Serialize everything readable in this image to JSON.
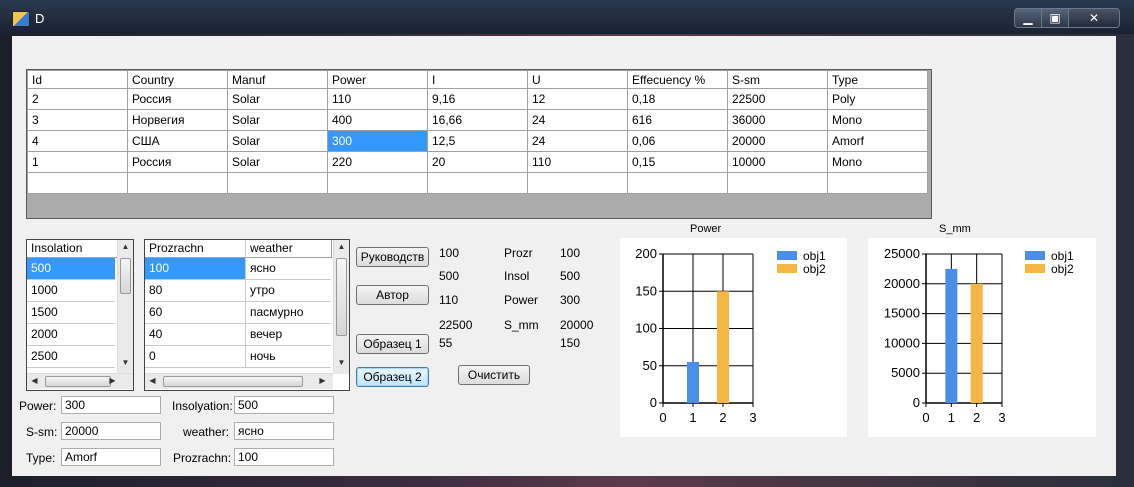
{
  "window": {
    "title": "D",
    "min_label": "▁",
    "max_label": "▣",
    "close_label": "✕"
  },
  "grid": {
    "columns": [
      "Id",
      "Country",
      "Manuf",
      "Power",
      "I",
      "U",
      "Effecuency %",
      "S-sm",
      "Type"
    ],
    "rows": [
      [
        "2",
        "Россия",
        "Solar",
        "110",
        "9,16",
        "12",
        "0,18",
        "22500",
        "Poly"
      ],
      [
        "3",
        "Норвегия",
        "Solar",
        "400",
        "16,66",
        "24",
        "616",
        "36000",
        "Mono"
      ],
      [
        "4",
        "США",
        "Solar",
        "300",
        "12,5",
        "24",
        "0,06",
        "20000",
        "Amorf"
      ],
      [
        "1",
        "Россия",
        "Solar",
        "220",
        "20",
        "110",
        "0,15",
        "10000",
        "Mono"
      ],
      [
        "",
        "",
        "",
        "",
        "",
        "",
        "",
        "",
        ""
      ]
    ],
    "selected_row": 2,
    "selected_col": 3
  },
  "insolation_list": {
    "header": "Insolation",
    "items": [
      "500",
      "1000",
      "1500",
      "2000",
      "2500"
    ],
    "selected": 0
  },
  "prozrachn_list": {
    "headers": [
      "Prozrachn",
      "weather"
    ],
    "rows": [
      [
        "100",
        "ясно"
      ],
      [
        "80",
        "утро"
      ],
      [
        "60",
        "пасмурно"
      ],
      [
        "40",
        "вечер"
      ],
      [
        "0",
        "ночь"
      ]
    ],
    "selected": 0
  },
  "buttons": {
    "rukovodstvo": "Руководств",
    "avtor": "Автор",
    "obrazec1": "Образец 1",
    "obrazec2": "Образец 2",
    "ochistit": "Очистить"
  },
  "values_col1": [
    "100",
    "500",
    "110",
    "22500",
    "55"
  ],
  "labels_col2": [
    "Prozr",
    "Insol",
    "Power",
    "S_mm"
  ],
  "values_col3": [
    "100",
    "500",
    "300",
    "20000",
    "150"
  ],
  "form": {
    "power_label": "Power:",
    "power_value": "300",
    "ssm_label": "S-sm:",
    "ssm_value": "20000",
    "type_label": "Type:",
    "type_value": "Amorf",
    "insolation_label": "Insolyation:",
    "insolation_value": "500",
    "weather_label": "weather:",
    "weather_value": "ясно",
    "prozrachn_label": "Prozrachn:",
    "prozrachn_value": "100"
  },
  "chart_data": [
    {
      "type": "bar",
      "title": "Power",
      "x_ticks": [
        "0",
        "1",
        "2",
        "3"
      ],
      "y_ticks": [
        "0",
        "50",
        "100",
        "150",
        "200"
      ],
      "ylim": [
        0,
        200
      ],
      "xlim": [
        0,
        3
      ],
      "series": [
        {
          "name": "obj1",
          "color": "#4a8fe7",
          "x": [
            1
          ],
          "values": [
            55
          ]
        },
        {
          "name": "obj2",
          "color": "#f6b645",
          "x": [
            2
          ],
          "values": [
            150
          ]
        }
      ],
      "legend": "top-right",
      "grid": true
    },
    {
      "type": "bar",
      "title": "S_mm",
      "x_ticks": [
        "0",
        "1",
        "2",
        "3"
      ],
      "y_ticks": [
        "0",
        "5000",
        "10000",
        "15000",
        "20000",
        "25000"
      ],
      "ylim": [
        0,
        25000
      ],
      "xlim": [
        0,
        3
      ],
      "series": [
        {
          "name": "obj1",
          "color": "#4a8fe7",
          "x": [
            1
          ],
          "values": [
            22500
          ]
        },
        {
          "name": "obj2",
          "color": "#f6b645",
          "x": [
            2
          ],
          "values": [
            20000
          ]
        }
      ],
      "legend": "top-right",
      "grid": true
    }
  ]
}
